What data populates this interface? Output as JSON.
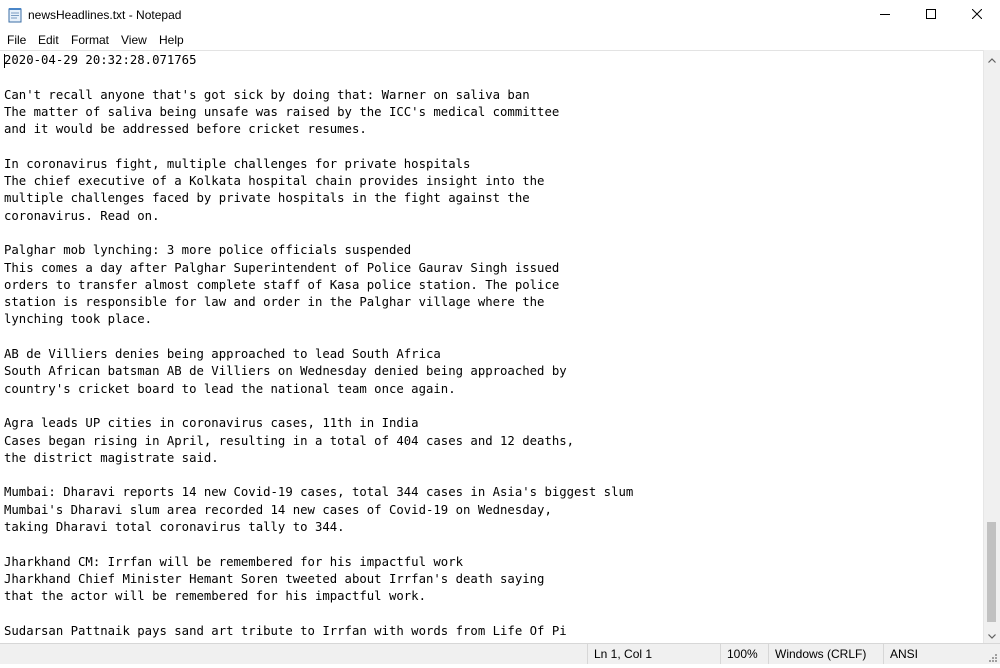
{
  "window": {
    "title": "newsHeadlines.txt - Notepad"
  },
  "menu": {
    "file": "File",
    "edit": "Edit",
    "format": "Format",
    "view": "View",
    "help": "Help"
  },
  "editor": {
    "content": "2020-04-29 20:32:28.071765\n\nCan't recall anyone that's got sick by doing that: Warner on saliva ban\nThe matter of saliva being unsafe was raised by the ICC's medical committee\nand it would be addressed before cricket resumes.\n\nIn coronavirus fight, multiple challenges for private hospitals\nThe chief executive of a Kolkata hospital chain provides insight into the\nmultiple challenges faced by private hospitals in the fight against the\ncoronavirus. Read on.\n\nPalghar mob lynching: 3 more police officials suspended\nThis comes a day after Palghar Superintendent of Police Gaurav Singh issued\norders to transfer almost complete staff of Kasa police station. The police\nstation is responsible for law and order in the Palghar village where the\nlynching took place.\n\nAB de Villiers denies being approached to lead South Africa\nSouth African batsman AB de Villiers on Wednesday denied being approached by\ncountry's cricket board to lead the national team once again.\n\nAgra leads UP cities in coronavirus cases, 11th in India\nCases began rising in April, resulting in a total of 404 cases and 12 deaths,\nthe district magistrate said.\n\nMumbai: Dharavi reports 14 new Covid-19 cases, total 344 cases in Asia's biggest slum\nMumbai's Dharavi slum area recorded 14 new cases of Covid-19 on Wednesday,\ntaking Dharavi total coronavirus tally to 344.\n\nJharkhand CM: Irrfan will be remembered for his impactful work\nJharkhand Chief Minister Hemant Soren tweeted about Irrfan's death saying\nthat the actor will be remembered for his impactful work.\n\nSudarsan Pattnaik pays sand art tribute to Irrfan with words from Life Of Pi"
  },
  "status": {
    "position": "Ln 1, Col 1",
    "zoom": "100%",
    "line_ending": "Windows (CRLF)",
    "encoding": "ANSI"
  },
  "icons": {
    "app": "notepad-icon",
    "minimize": "minimize-icon",
    "maximize": "maximize-icon",
    "close": "close-icon",
    "scroll_up": "chevron-up-icon",
    "scroll_down": "chevron-down-icon",
    "grip": "resize-grip-icon"
  }
}
